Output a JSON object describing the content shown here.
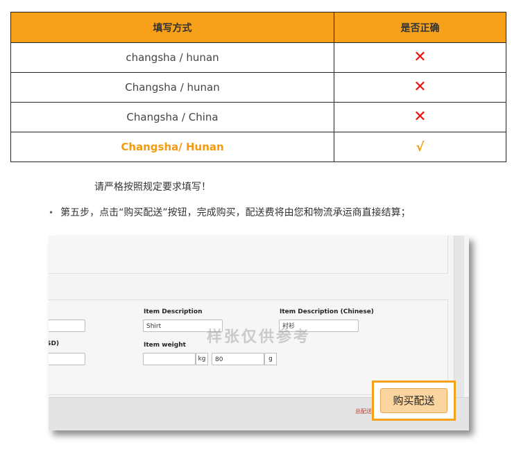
{
  "table": {
    "headers": [
      "填写方式",
      "是否正确"
    ],
    "rows": [
      {
        "way": "changsha / hunan",
        "result": "✕"
      },
      {
        "way": "Changsha / hunan",
        "result": "✕"
      },
      {
        "way": "Changsha / China",
        "result": "✕"
      },
      {
        "way": "Changsha/ Hunan",
        "result": "√"
      }
    ]
  },
  "notes": {
    "strict": "请严格按照规定要求填写！",
    "bullet": "•",
    "step5": "第五步，点击“购买配送”按钮，完成购买，配送费将由您和物流承运商直接结算；"
  },
  "screenshot": {
    "item_description_label": "Item Description",
    "item_description_value": "Shirt",
    "item_description_cn_label": "Item Description (Chinese)",
    "item_description_cn_value": "衬衫",
    "item_weight_label": "Item weight",
    "weight_kg_unit": "kg",
    "weight_g_value": "80",
    "weight_g_unit": "g",
    "left_partial_label": "SD)",
    "total_label": "总配送",
    "buy_button": "购买配送",
    "watermark": "样张仅供参考"
  },
  "colors": {
    "header_bg": "#f7a11a",
    "wrong_mark": "#e8110f",
    "correct": "#f59a0c"
  }
}
